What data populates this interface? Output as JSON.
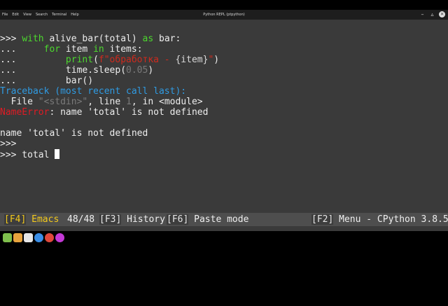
{
  "window": {
    "title": "Python REPL (ptpython)",
    "menu": [
      "File",
      "Edit",
      "View",
      "Search",
      "Terminal",
      "Help"
    ],
    "controls": [
      "minimize",
      "maximize",
      "close"
    ]
  },
  "terminal": {
    "lines": [
      [
        {
          "t": ">>> ",
          "c": ""
        },
        {
          "t": "with",
          "c": "kw"
        },
        {
          "t": " alive_bar(total) ",
          "c": ""
        },
        {
          "t": "as",
          "c": "kw"
        },
        {
          "t": " bar:",
          "c": ""
        }
      ],
      [
        {
          "t": "...     ",
          "c": ""
        },
        {
          "t": "for",
          "c": "kw"
        },
        {
          "t": " item ",
          "c": ""
        },
        {
          "t": "in",
          "c": "kw"
        },
        {
          "t": " items:",
          "c": ""
        }
      ],
      [
        {
          "t": "...         ",
          "c": ""
        },
        {
          "t": "print",
          "c": "kw"
        },
        {
          "t": "(",
          "c": ""
        },
        {
          "t": "f\"обработка - ",
          "c": "str"
        },
        {
          "t": "{item}",
          "c": "fn"
        },
        {
          "t": "\"",
          "c": "str"
        },
        {
          "t": ")",
          "c": ""
        }
      ],
      [
        {
          "t": "...         ",
          "c": ""
        },
        {
          "t": "time",
          "c": ""
        },
        {
          "t": ".",
          "c": ""
        },
        {
          "t": "sleep(",
          "c": ""
        },
        {
          "t": "0.05",
          "c": "num"
        },
        {
          "t": ")",
          "c": ""
        }
      ],
      [
        {
          "t": "...         ",
          "c": ""
        },
        {
          "t": "bar()",
          "c": ""
        }
      ],
      [
        {
          "t": "Traceback (most recent call last):",
          "c": "tb"
        }
      ],
      [
        {
          "t": "  File ",
          "c": ""
        },
        {
          "t": "\"<stdin>\"",
          "c": "num"
        },
        {
          "t": ", line ",
          "c": ""
        },
        {
          "t": "1",
          "c": "num"
        },
        {
          "t": ", in <module>",
          "c": ""
        }
      ],
      [
        {
          "t": "NameError",
          "c": "err"
        },
        {
          "t": ": name 'total' is not defined",
          "c": ""
        }
      ],
      [
        {
          "t": "",
          "c": ""
        }
      ],
      [
        {
          "t": "name 'total' is not defined",
          "c": ""
        }
      ],
      [
        {
          "t": ">>>",
          "c": ""
        }
      ],
      [
        {
          "t": ">>> total ",
          "c": ""
        }
      ]
    ]
  },
  "statusbar": {
    "mode_key": "[F4]",
    "mode": " Emacs ",
    "position": "48/48",
    "history_key": "[F3]",
    "history": " History ",
    "paste_key": "[F6]",
    "paste": " Paste mode",
    "menu_key": "[F2]",
    "menu": " Menu - CPython 3.8.5 "
  },
  "taskbar": {
    "icons": [
      {
        "name": "mint-menu-icon",
        "color": "#7fbf4d"
      },
      {
        "name": "files-icon",
        "color": "#e8a33d"
      },
      {
        "name": "terminal-icon",
        "color": "#e6e6e6"
      },
      {
        "name": "vscode-icon",
        "color": "#3a8ee6"
      },
      {
        "name": "chrome-icon",
        "color": "#e0483b"
      },
      {
        "name": "firefox-icon",
        "color": "#c339d6"
      }
    ]
  }
}
